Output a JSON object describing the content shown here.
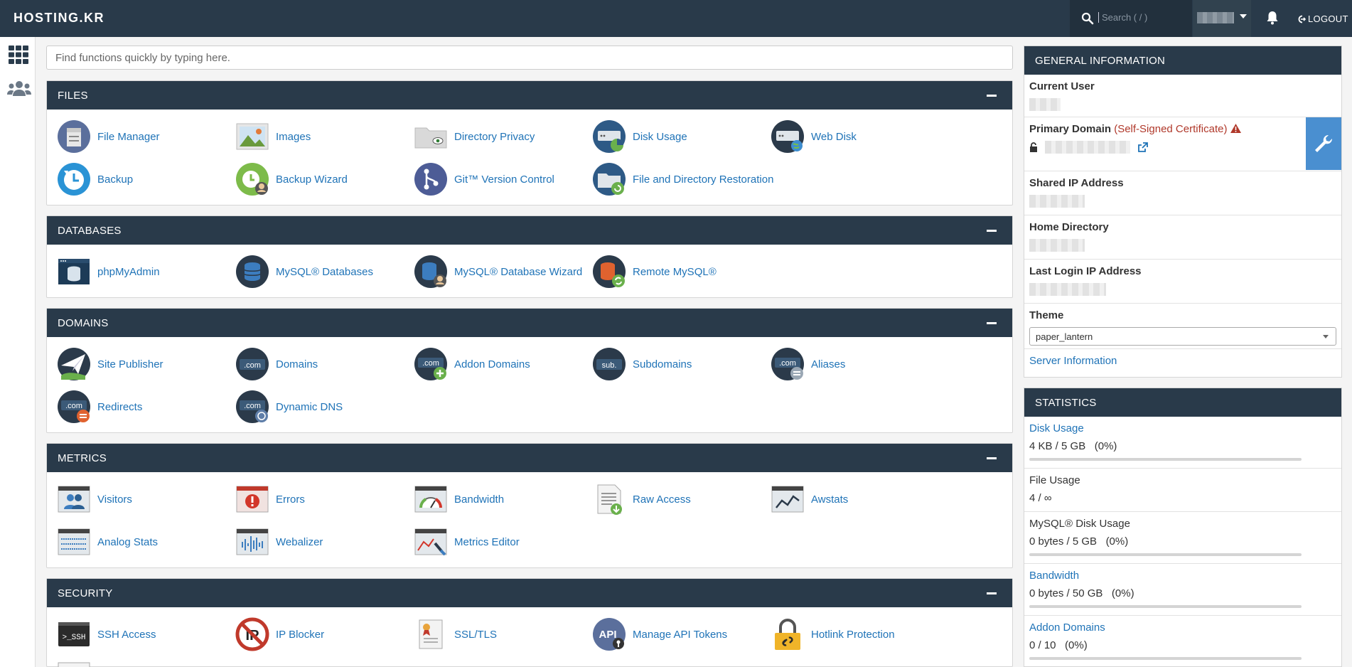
{
  "topbar": {
    "logo": "HOSTING.KR",
    "search_placeholder": "Search ( / )",
    "logout_label": "LOGOUT"
  },
  "quick_search": {
    "placeholder": "Find functions quickly by typing here."
  },
  "sections": {
    "files": {
      "title": "FILES",
      "items": [
        "File Manager",
        "Images",
        "Directory Privacy",
        "Disk Usage",
        "Web Disk",
        "Backup",
        "Backup Wizard",
        "Git™ Version Control",
        "File and Directory Restoration"
      ]
    },
    "databases": {
      "title": "DATABASES",
      "items": [
        "phpMyAdmin",
        "MySQL® Databases",
        "MySQL® Database Wizard",
        "Remote MySQL®"
      ]
    },
    "domains": {
      "title": "DOMAINS",
      "items": [
        "Site Publisher",
        "Domains",
        "Addon Domains",
        "Subdomains",
        "Aliases",
        "Redirects",
        "Dynamic DNS"
      ]
    },
    "metrics": {
      "title": "METRICS",
      "items": [
        "Visitors",
        "Errors",
        "Bandwidth",
        "Raw Access",
        "Awstats",
        "Analog Stats",
        "Webalizer",
        "Metrics Editor"
      ]
    },
    "security": {
      "title": "SECURITY",
      "items": [
        "SSH Access",
        "IP Blocker",
        "SSL/TLS",
        "Manage API Tokens",
        "Hotlink Protection"
      ]
    }
  },
  "general_info": {
    "title": "GENERAL INFORMATION",
    "current_user": "Current User",
    "primary_domain": "Primary Domain",
    "cert_warning": "(Self-Signed Certificate)",
    "shared_ip": "Shared IP Address",
    "home_dir": "Home Directory",
    "last_login": "Last Login IP Address",
    "theme_label": "Theme",
    "theme_value": "paper_lantern",
    "server_info": "Server Information"
  },
  "statistics": {
    "title": "STATISTICS",
    "rows": [
      {
        "label": "Disk Usage",
        "value": "4 KB / 5 GB",
        "percent": "(0%)",
        "fraction": 0.0
      },
      {
        "label": "File Usage",
        "value": "4 / ∞"
      },
      {
        "label": "MySQL® Disk Usage",
        "value": "0 bytes / 5 GB",
        "percent": "(0%)",
        "fraction": 0.0
      },
      {
        "label": "Bandwidth",
        "value": "0 bytes / 50 GB",
        "percent": "(0%)",
        "fraction": 0.0
      },
      {
        "label": "Addon Domains",
        "value": "0 / 10",
        "percent": "(0%)",
        "fraction": 0.0
      }
    ]
  },
  "colors": {
    "topbar": "#293a4a",
    "link": "#1f73b7",
    "accent": "#4a8fd0",
    "warning": "#b0382a"
  }
}
